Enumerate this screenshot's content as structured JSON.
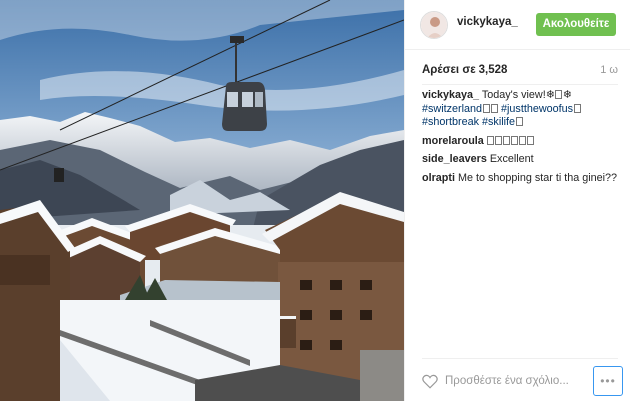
{
  "post": {
    "username": "vickykaya_",
    "follow_label": "Ακολουθείτε",
    "likes_label": "Αρέσει σε",
    "likes_count": "3,528",
    "time_ago": "1 ω"
  },
  "comments": [
    {
      "author": "vickykaya_",
      "segments": [
        {
          "kind": "text",
          "value": "Today's view!❄"
        },
        {
          "kind": "glyph"
        },
        {
          "kind": "text",
          "value": "❄"
        },
        {
          "kind": "br"
        },
        {
          "kind": "tag",
          "value": "#switzerland"
        },
        {
          "kind": "glyph"
        },
        {
          "kind": "glyph"
        },
        {
          "kind": "text",
          "value": " "
        },
        {
          "kind": "tag",
          "value": "#justthewoofus"
        },
        {
          "kind": "glyph"
        },
        {
          "kind": "br"
        },
        {
          "kind": "tag",
          "value": "#shortbreak"
        },
        {
          "kind": "text",
          "value": " "
        },
        {
          "kind": "tag",
          "value": "#skilife"
        },
        {
          "kind": "glyph"
        }
      ]
    },
    {
      "author": "morelaroula",
      "segments": [
        {
          "kind": "glyph"
        },
        {
          "kind": "glyph"
        },
        {
          "kind": "glyph"
        },
        {
          "kind": "glyph"
        },
        {
          "kind": "glyph"
        },
        {
          "kind": "glyph"
        }
      ]
    },
    {
      "author": "side_leavers",
      "segments": [
        {
          "kind": "text",
          "value": "Excellent"
        }
      ]
    },
    {
      "author": "olrapti",
      "segments": [
        {
          "kind": "text",
          "value": "Me to shopping star ti tha ginei??"
        }
      ]
    }
  ],
  "footer": {
    "comment_placeholder": "Προσθέστε ένα σχόλιο...",
    "more_label": "•••"
  },
  "icons": {
    "like": "heart-outline-icon",
    "more": "more-options-icon"
  },
  "colors": {
    "follow_button": "#70c050",
    "hashtag": "#003569",
    "more_border": "#3897f0"
  }
}
